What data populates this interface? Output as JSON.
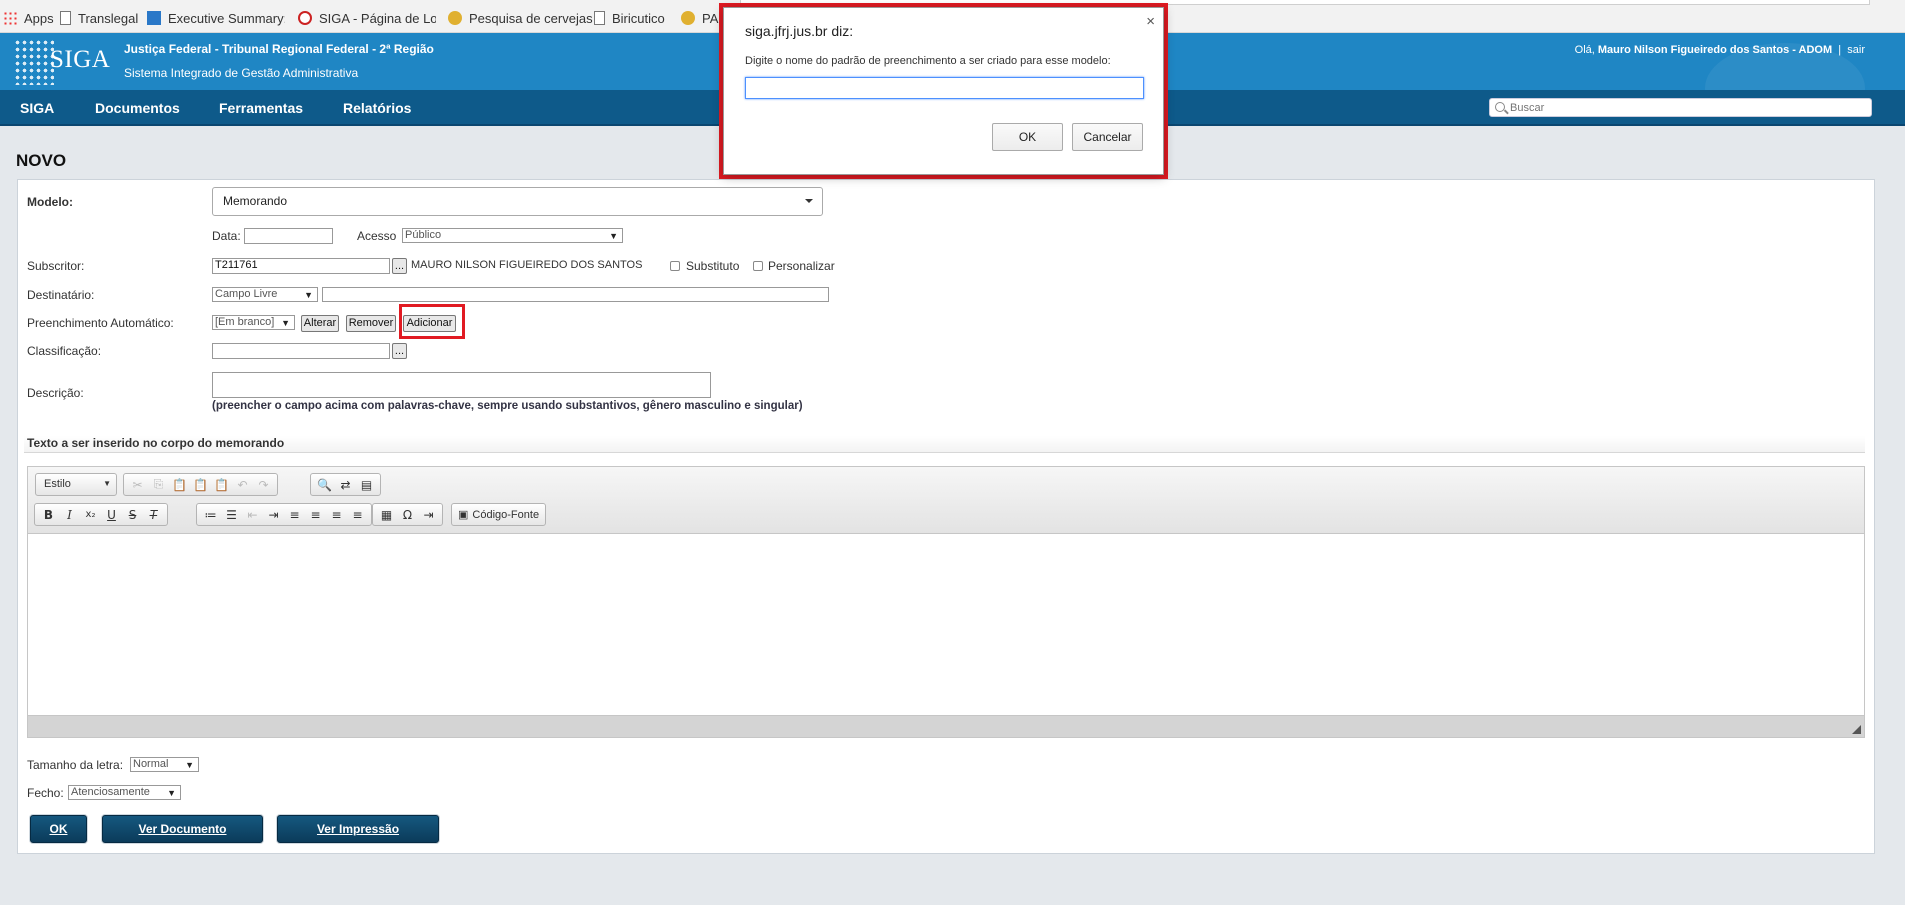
{
  "bookmarks": [
    {
      "label": "Apps",
      "icon": "apps-grid-icon"
    },
    {
      "label": "Translegal",
      "icon": "page-icon"
    },
    {
      "label": "Executive Summary: ",
      "icon": "exec-summary-icon"
    },
    {
      "label": "SIGA - Página de Log",
      "icon": "siga-icon"
    },
    {
      "label": "Pesquisa de cervejas",
      "icon": "beer-icon"
    },
    {
      "label": "Biricutico",
      "icon": "page-icon"
    },
    {
      "label": "PAI",
      "icon": "beer-icon"
    }
  ],
  "header": {
    "logo_text": "SIGA",
    "title": "Justiça Federal - Tribunal Regional Federal - 2ª Região",
    "subtitle": "Sistema Integrado de Gestão Administrativa",
    "greeting": "Olá,",
    "user": "Mauro Nilson Figueiredo dos Santos - ADOM",
    "separator": "|",
    "logout": "sair"
  },
  "nav": {
    "items": [
      "SIGA",
      "Documentos",
      "Ferramentas",
      "Relatórios"
    ],
    "search_placeholder": "Buscar"
  },
  "page": {
    "title": "NOVO"
  },
  "form": {
    "modelo_label": "Modelo:",
    "modelo_value": "Memorando",
    "data_label": "Data:",
    "data_value": "",
    "acesso_label": "Acesso",
    "acesso_value": "Público",
    "subscritor_label": "Subscritor:",
    "subscritor_value": "T211761",
    "subscritor_name": "MAURO NILSON FIGUEIREDO DOS SANTOS",
    "substituto_label": "Substituto",
    "personalizar_label": "Personalizar",
    "destinatario_label": "Destinatário:",
    "destinatario_type": "Campo Livre",
    "destinatario_value": "",
    "preenchimento_label": "Preenchimento Automático:",
    "preenchimento_value": "[Em branco]",
    "alterar": "Alterar",
    "remover": "Remover",
    "adicionar": "Adicionar",
    "classificacao_label": "Classificação:",
    "classificacao_value": "",
    "descricao_label": "Descrição:",
    "descricao_value": "",
    "descricao_hint": "(preencher o campo acima com palavras-chave, sempre usando substantivos, gênero masculino e singular)",
    "lookup": "...",
    "select_arrow": "▼"
  },
  "editor": {
    "section_title": "Texto a ser inserido no corpo do memorando",
    "style_combo": "Estilo",
    "source_button": "Código-Fonte"
  },
  "footer_form": {
    "tamanho_label": "Tamanho da letra:",
    "tamanho_value": "Normal",
    "fecho_label": "Fecho:",
    "fecho_value": "Atenciosamente"
  },
  "actions": {
    "ok": "OK",
    "ver_documento": "Ver Documento",
    "ver_impressao": "Ver Impressão"
  },
  "dialog": {
    "title": "siga.jfrj.jus.br diz:",
    "message": "Digite o nome do padrão de preenchimento a ser criado para esse modelo:",
    "input_value": "",
    "ok": "OK",
    "cancel": "Cancelar",
    "close": "×"
  },
  "colors": {
    "header_bg": "#1f86c4",
    "nav_bg": "#0e5a8a",
    "highlight": "#e11a22",
    "action_button": "#0b3b5a"
  }
}
